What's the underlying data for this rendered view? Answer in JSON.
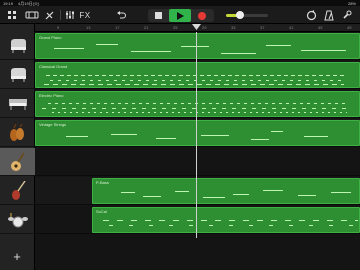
{
  "status": {
    "time": "19:19",
    "date": "4月19日(火)",
    "battery": "28%"
  },
  "toolbar": {
    "fx_label": "FX"
  },
  "ruler": {
    "bars": [
      "9",
      "13",
      "17",
      "21",
      "25",
      "29",
      "33",
      "37",
      "41",
      "45",
      "49"
    ]
  },
  "tracks": [
    {
      "name": "Grand Piano",
      "icon": "grand-piano-icon"
    },
    {
      "name": "Classical Grand",
      "icon": "grand-piano-icon"
    },
    {
      "name": "Electric Piano",
      "icon": "electric-piano-icon"
    },
    {
      "name": "Vintage Strings",
      "icon": "strings-icon"
    },
    {
      "name": "",
      "icon": "acoustic-guitar-icon"
    },
    {
      "name": "P-Bass",
      "icon": "bass-guitar-icon"
    },
    {
      "name": "SoCal",
      "icon": "drum-kit-icon"
    }
  ],
  "regions": [
    {
      "label": "Grand Piano"
    },
    {
      "label": "Classical Grand"
    },
    {
      "label": "Electric Piano"
    },
    {
      "label": "Vintage Strings"
    },
    {
      "label": "P-Bass"
    },
    {
      "label": "SoCal"
    }
  ],
  "colors": {
    "region": "#2e8f32",
    "region_border": "#3fb043",
    "note": "#bff5b2",
    "record": "#e53935",
    "play": "#2fb34a"
  }
}
